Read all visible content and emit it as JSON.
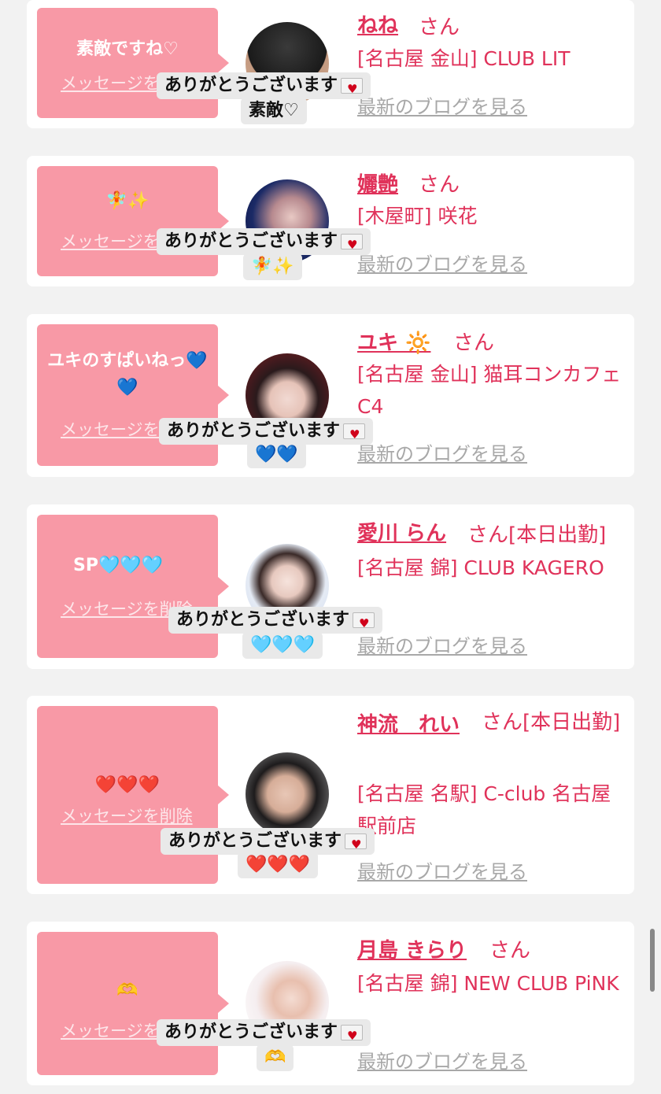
{
  "ui": {
    "delete_label": "メッセージを削除",
    "blog_label": "最新のブログを見る",
    "san_label": "さん",
    "reply_label": "ありがとうございます"
  },
  "cards": [
    {
      "message": "素敵ですね♡",
      "name": "ねね",
      "suffix": "さん",
      "shop": "[名古屋 金山] CLUB LIT",
      "reply_extra": "素敵♡"
    },
    {
      "message": "🧚✨",
      "name": "孋艶",
      "suffix": "さん",
      "shop": "[木屋町] 咲花",
      "reply_extra": "🧚✨"
    },
    {
      "message": "ユキのすぱいねっ💙💙",
      "name": "ユキ 🔆",
      "suffix": "さん",
      "shop": "[名古屋 金山] 猫耳コンカフェ C4",
      "reply_extra": "💙💙"
    },
    {
      "message": "SP🩵🩵🩵",
      "name": "愛川 らん",
      "suffix": "さん[本日出勤]",
      "shop": "[名古屋 錦] CLUB KAGERO",
      "reply_extra": "🩵🩵🩵"
    },
    {
      "message": "❤️❤️❤️",
      "name": "神流　れい",
      "suffix": "さん[本日出勤]",
      "shop": "[名古屋 名駅] C-club 名古屋駅前店",
      "reply_extra": "❤️❤️❤️"
    },
    {
      "message": "🫶",
      "name": "月島 きらり",
      "suffix": "さん",
      "shop": "[名古屋 錦] NEW CLUB PiNK",
      "reply_extra": "🫶"
    }
  ]
}
